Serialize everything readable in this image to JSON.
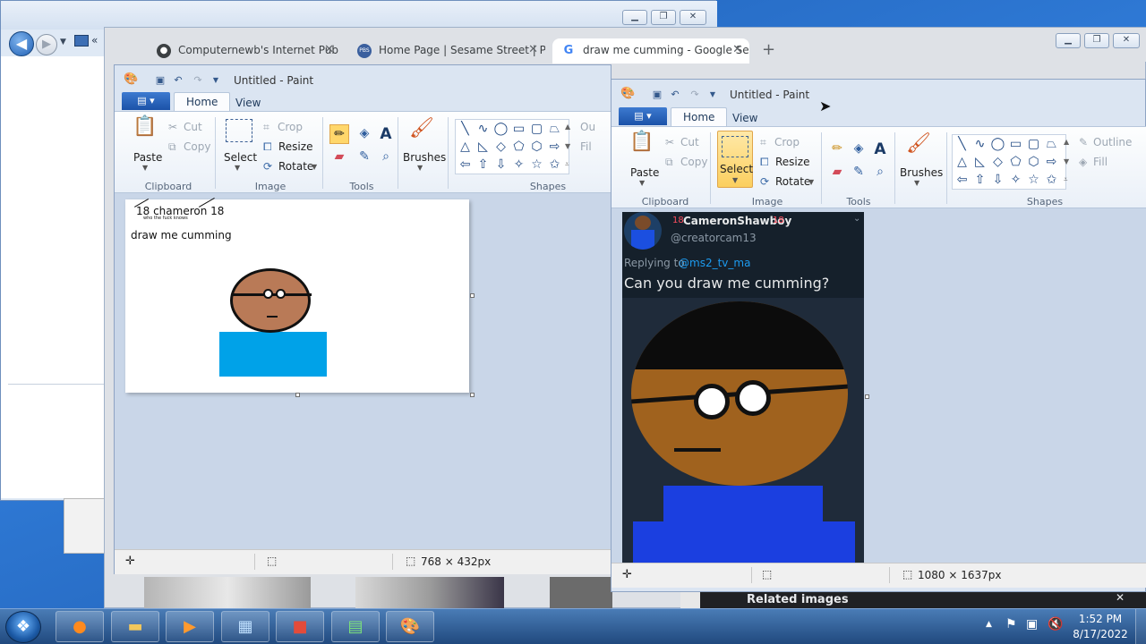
{
  "ie": {
    "back_icon": "back-arrow-icon",
    "forward_icon": "forward-arrow-icon"
  },
  "chrome": {
    "tabs": [
      {
        "label": "Computernewb's Internet Pub H",
        "icon": "incognito-icon"
      },
      {
        "label": "Home Page | Sesame Street | PB",
        "icon": "pbs-icon"
      },
      {
        "label": "draw me cumming - Google Se",
        "icon": "google-icon"
      }
    ],
    "new_tab": "+"
  },
  "paint_left": {
    "title": "Untitled - Paint",
    "tabs": {
      "file": "▤ ▾",
      "home": "Home",
      "view": "View"
    },
    "clipboard": {
      "paste": "Paste",
      "cut": "Cut",
      "copy": "Copy",
      "label": "Clipboard"
    },
    "image": {
      "select": "Select",
      "crop": "Crop",
      "resize": "Resize",
      "rotate": "Rotate",
      "label": "Image"
    },
    "tools": {
      "label": "Tools"
    },
    "brushes": {
      "label": "Brushes"
    },
    "shapes": {
      "label": "Shapes",
      "outline": "Ou",
      "fill": "Fil"
    },
    "canvas": {
      "handwriting_1": "18 chameron 18",
      "handwriting_2": "who the fuck knows",
      "caption": "draw me cumming"
    },
    "status": {
      "dims": "768 × 432px"
    }
  },
  "paint_right": {
    "title": "Untitled - Paint",
    "tabs": {
      "file": "▤ ▾",
      "home": "Home",
      "view": "View"
    },
    "clipboard": {
      "paste": "Paste",
      "cut": "Cut",
      "copy": "Copy",
      "label": "Clipboard"
    },
    "image": {
      "select": "Select",
      "crop": "Crop",
      "resize": "Resize",
      "rotate": "Rotate",
      "label": "Image"
    },
    "tools": {
      "label": "Tools"
    },
    "brushes": {
      "label": "Brushes"
    },
    "shapes": {
      "label": "Shapes",
      "outline": "Outline",
      "fill": "Fill"
    },
    "tweet": {
      "name": "CameronShawboy",
      "badge": "18",
      "handle": "@creatorcam13",
      "replying_prefix": "Replying to",
      "replying_to": "@ms2_tv_ma",
      "text": "Can you draw me cumming?"
    },
    "status": {
      "dims": "1080 × 1637px"
    },
    "bottom_strip": "Related images"
  },
  "taskbar": {
    "apps": [
      "firefox-icon",
      "folder-icon",
      "media-player-icon",
      "control-panel-icon",
      "toolbox-icon",
      "task-manager-icon",
      "paint-icon"
    ],
    "time": "1:52 PM",
    "date": "8/17/2022"
  }
}
